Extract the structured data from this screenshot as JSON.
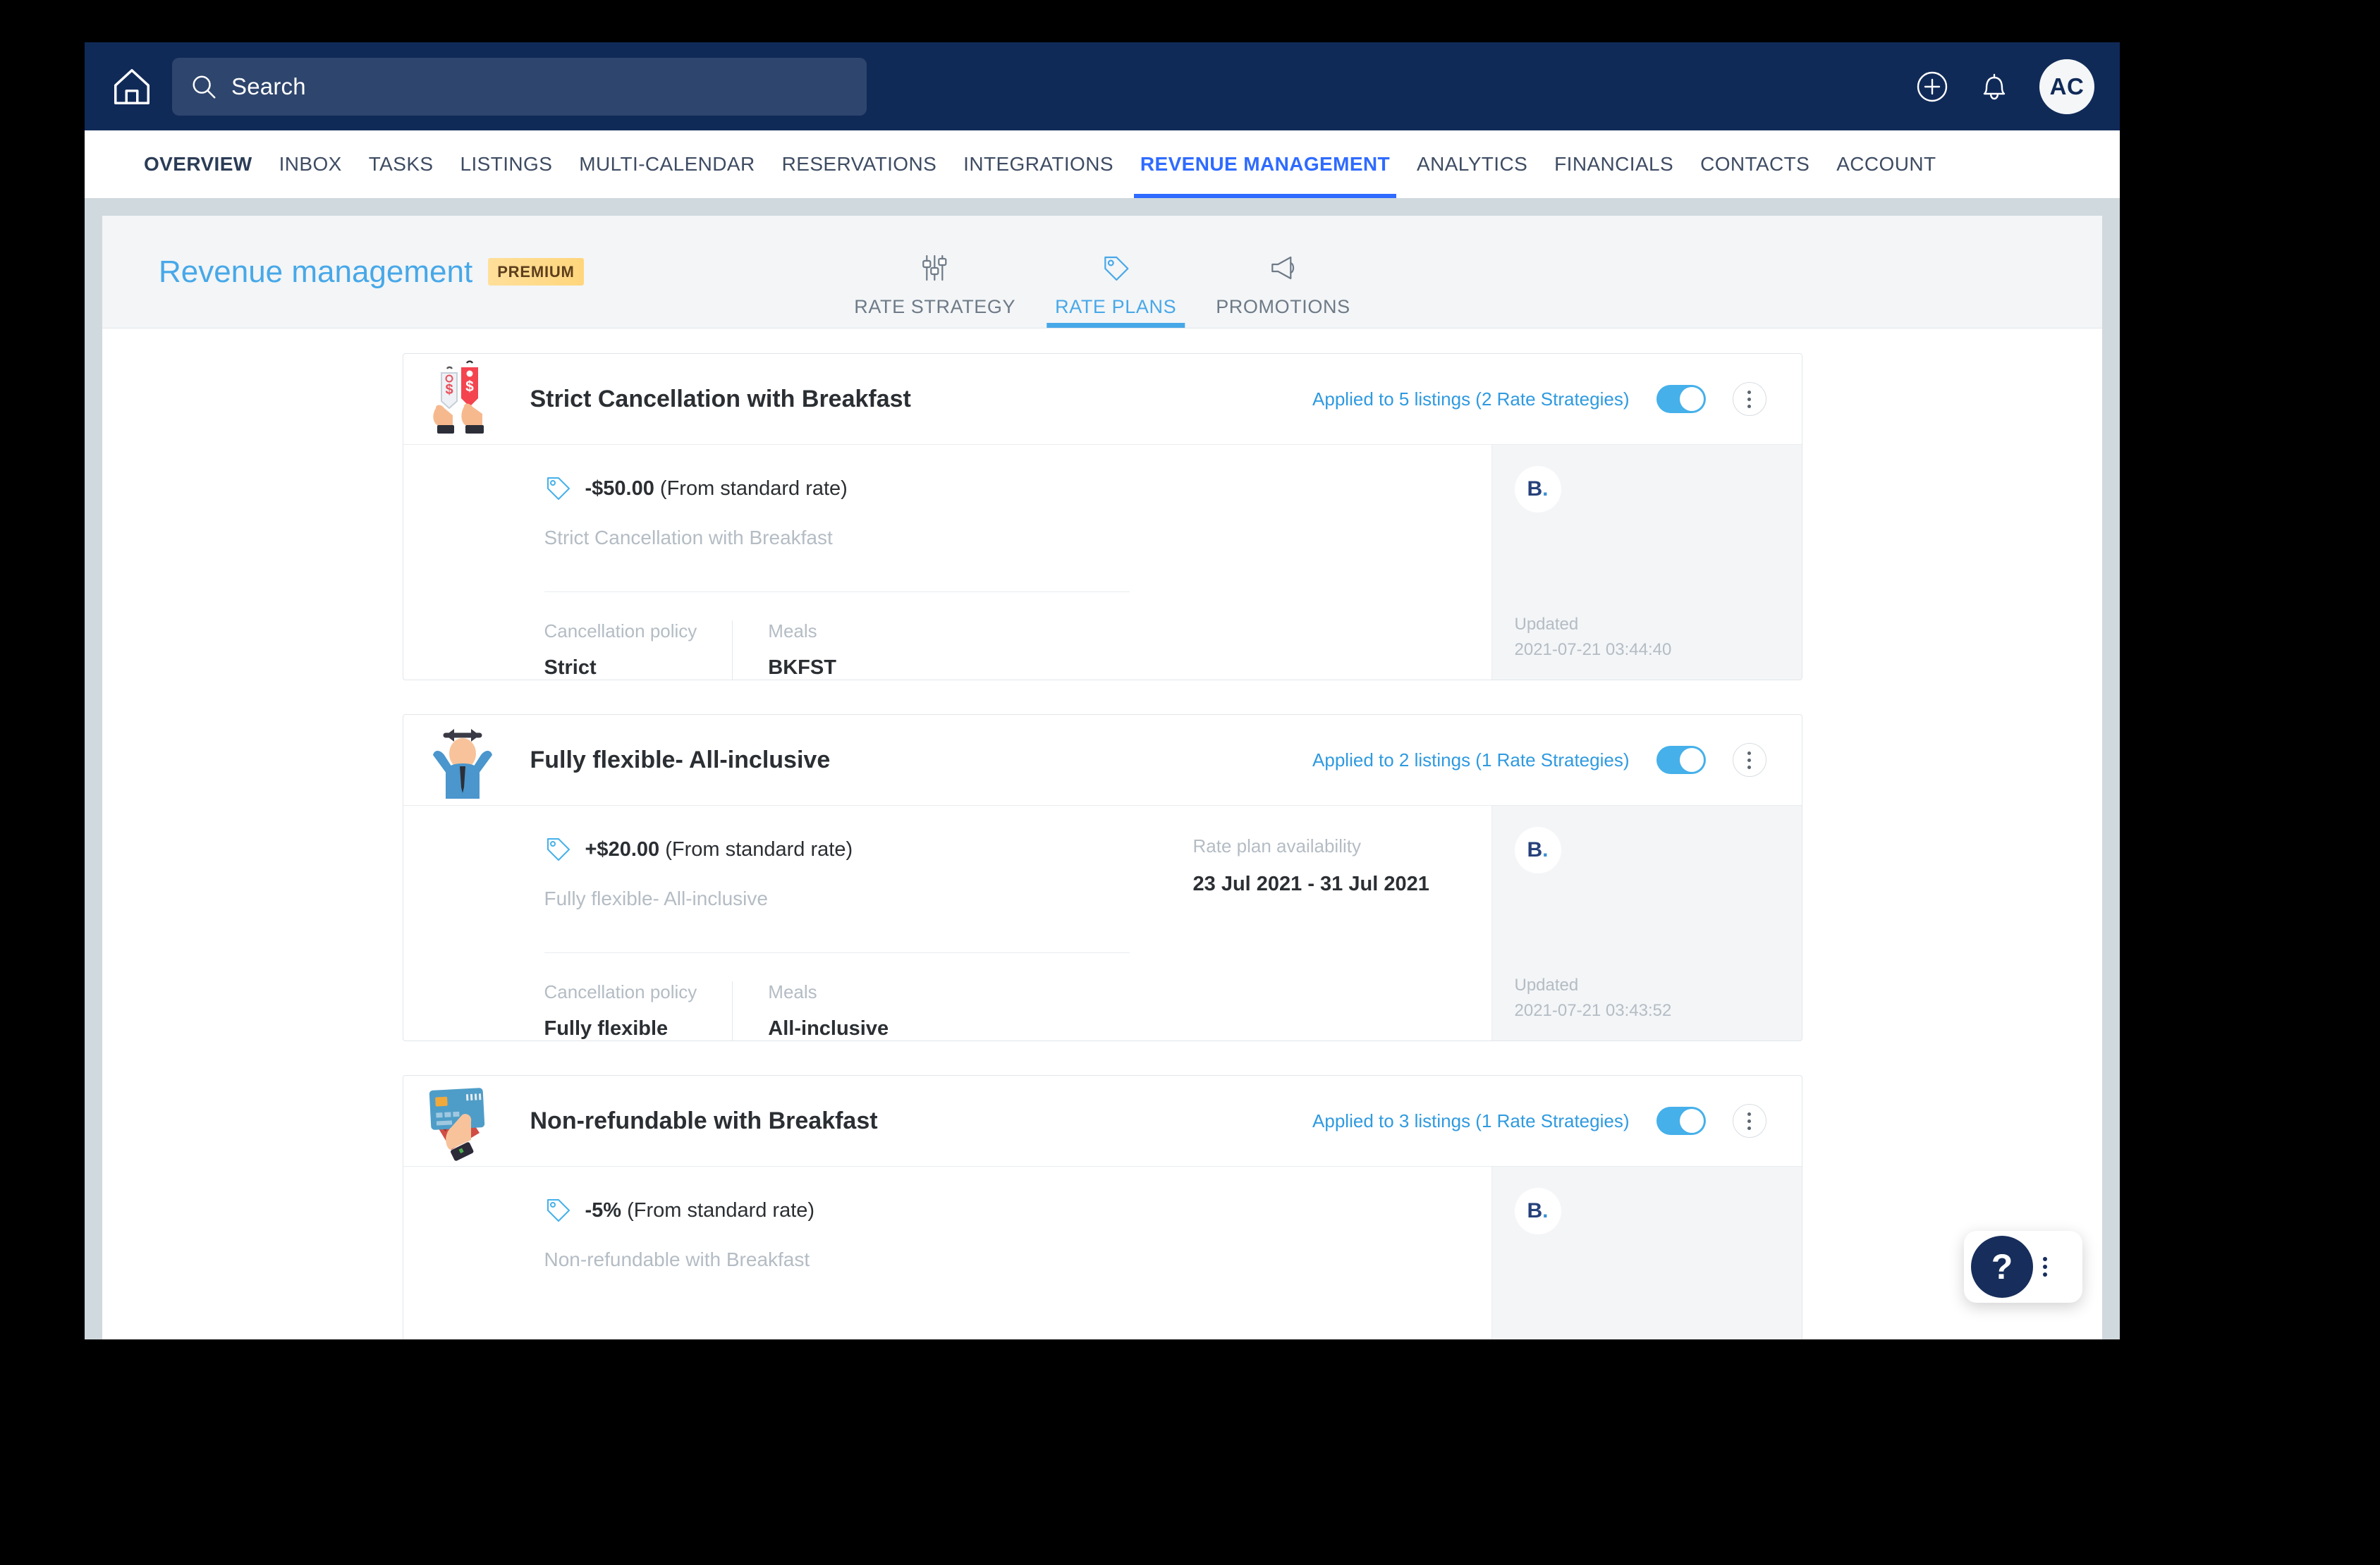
{
  "topbar": {
    "home_icon": "home-icon",
    "search": {
      "placeholder": "Search",
      "icon": "search-icon"
    },
    "add_icon": "plus-circle-icon",
    "notification_icon": "bell-icon",
    "avatar_initials": "AC"
  },
  "mainnav": {
    "items": [
      {
        "label": "OVERVIEW",
        "state": "bold"
      },
      {
        "label": "INBOX",
        "state": "normal"
      },
      {
        "label": "TASKS",
        "state": "normal"
      },
      {
        "label": "LISTINGS",
        "state": "normal"
      },
      {
        "label": "MULTI-CALENDAR",
        "state": "normal"
      },
      {
        "label": "RESERVATIONS",
        "state": "normal"
      },
      {
        "label": "INTEGRATIONS",
        "state": "normal"
      },
      {
        "label": "REVENUE MANAGEMENT",
        "state": "active"
      },
      {
        "label": "ANALYTICS",
        "state": "normal"
      },
      {
        "label": "FINANCIALS",
        "state": "normal"
      },
      {
        "label": "CONTACTS",
        "state": "normal"
      },
      {
        "label": "ACCOUNT",
        "state": "normal"
      }
    ]
  },
  "page": {
    "title": "Revenue management",
    "badge": "PREMIUM",
    "accent_color": "#47a8e8",
    "badge_color": "#ffd67c",
    "subtabs": [
      {
        "label": "RATE STRATEGY",
        "icon": "sliders-icon",
        "active": false
      },
      {
        "label": "RATE PLANS",
        "icon": "price-tag-icon",
        "active": true
      },
      {
        "label": "PROMOTIONS",
        "icon": "megaphone-icon",
        "active": false
      }
    ]
  },
  "rate_plans": [
    {
      "name": "Strict Cancellation with Breakfast",
      "illustration": "price-tags-in-hands-illustration",
      "applied_label": "Applied to 5 listings (2 Rate Strategies)",
      "enabled": true,
      "price_adjustment": "-$50.00",
      "price_suffix": " (From standard rate)",
      "description": "Strict Cancellation with Breakfast",
      "availability_label": "",
      "availability_value": "",
      "meta": [
        {
          "label": "Cancellation policy",
          "value": "Strict"
        },
        {
          "label": "Meals",
          "value": "BKFST"
        }
      ],
      "channel_logo": "B",
      "channel_logo_dot": ".",
      "updated_label": "Updated",
      "updated_value": "2021-07-21 03:44:40"
    },
    {
      "name": "Fully flexible- All-inclusive",
      "illustration": "person-with-arrows-illustration",
      "applied_label": "Applied to 2 listings (1 Rate Strategies)",
      "enabled": true,
      "price_adjustment": "+$20.00",
      "price_suffix": " (From standard rate)",
      "description": "Fully flexible- All-inclusive",
      "availability_label": "Rate plan availability",
      "availability_value": "23 Jul 2021 - 31 Jul 2021",
      "meta": [
        {
          "label": "Cancellation policy",
          "value": "Fully flexible"
        },
        {
          "label": "Meals",
          "value": "All-inclusive"
        }
      ],
      "channel_logo": "B",
      "channel_logo_dot": ".",
      "updated_label": "Updated",
      "updated_value": "2021-07-21 03:43:52"
    },
    {
      "name": "Non-refundable with Breakfast",
      "illustration": "hand-holding-credit-card-illustration",
      "applied_label": "Applied to 3 listings (1 Rate Strategies)",
      "enabled": true,
      "price_adjustment": "-5%",
      "price_suffix": " (From standard rate)",
      "description": "Non-refundable with Breakfast",
      "availability_label": "",
      "availability_value": "",
      "meta": [],
      "channel_logo": "B",
      "channel_logo_dot": ".",
      "updated_label": "",
      "updated_value": ""
    }
  ],
  "help_widget": {
    "label": "?",
    "kebab": "more-options-icon"
  }
}
